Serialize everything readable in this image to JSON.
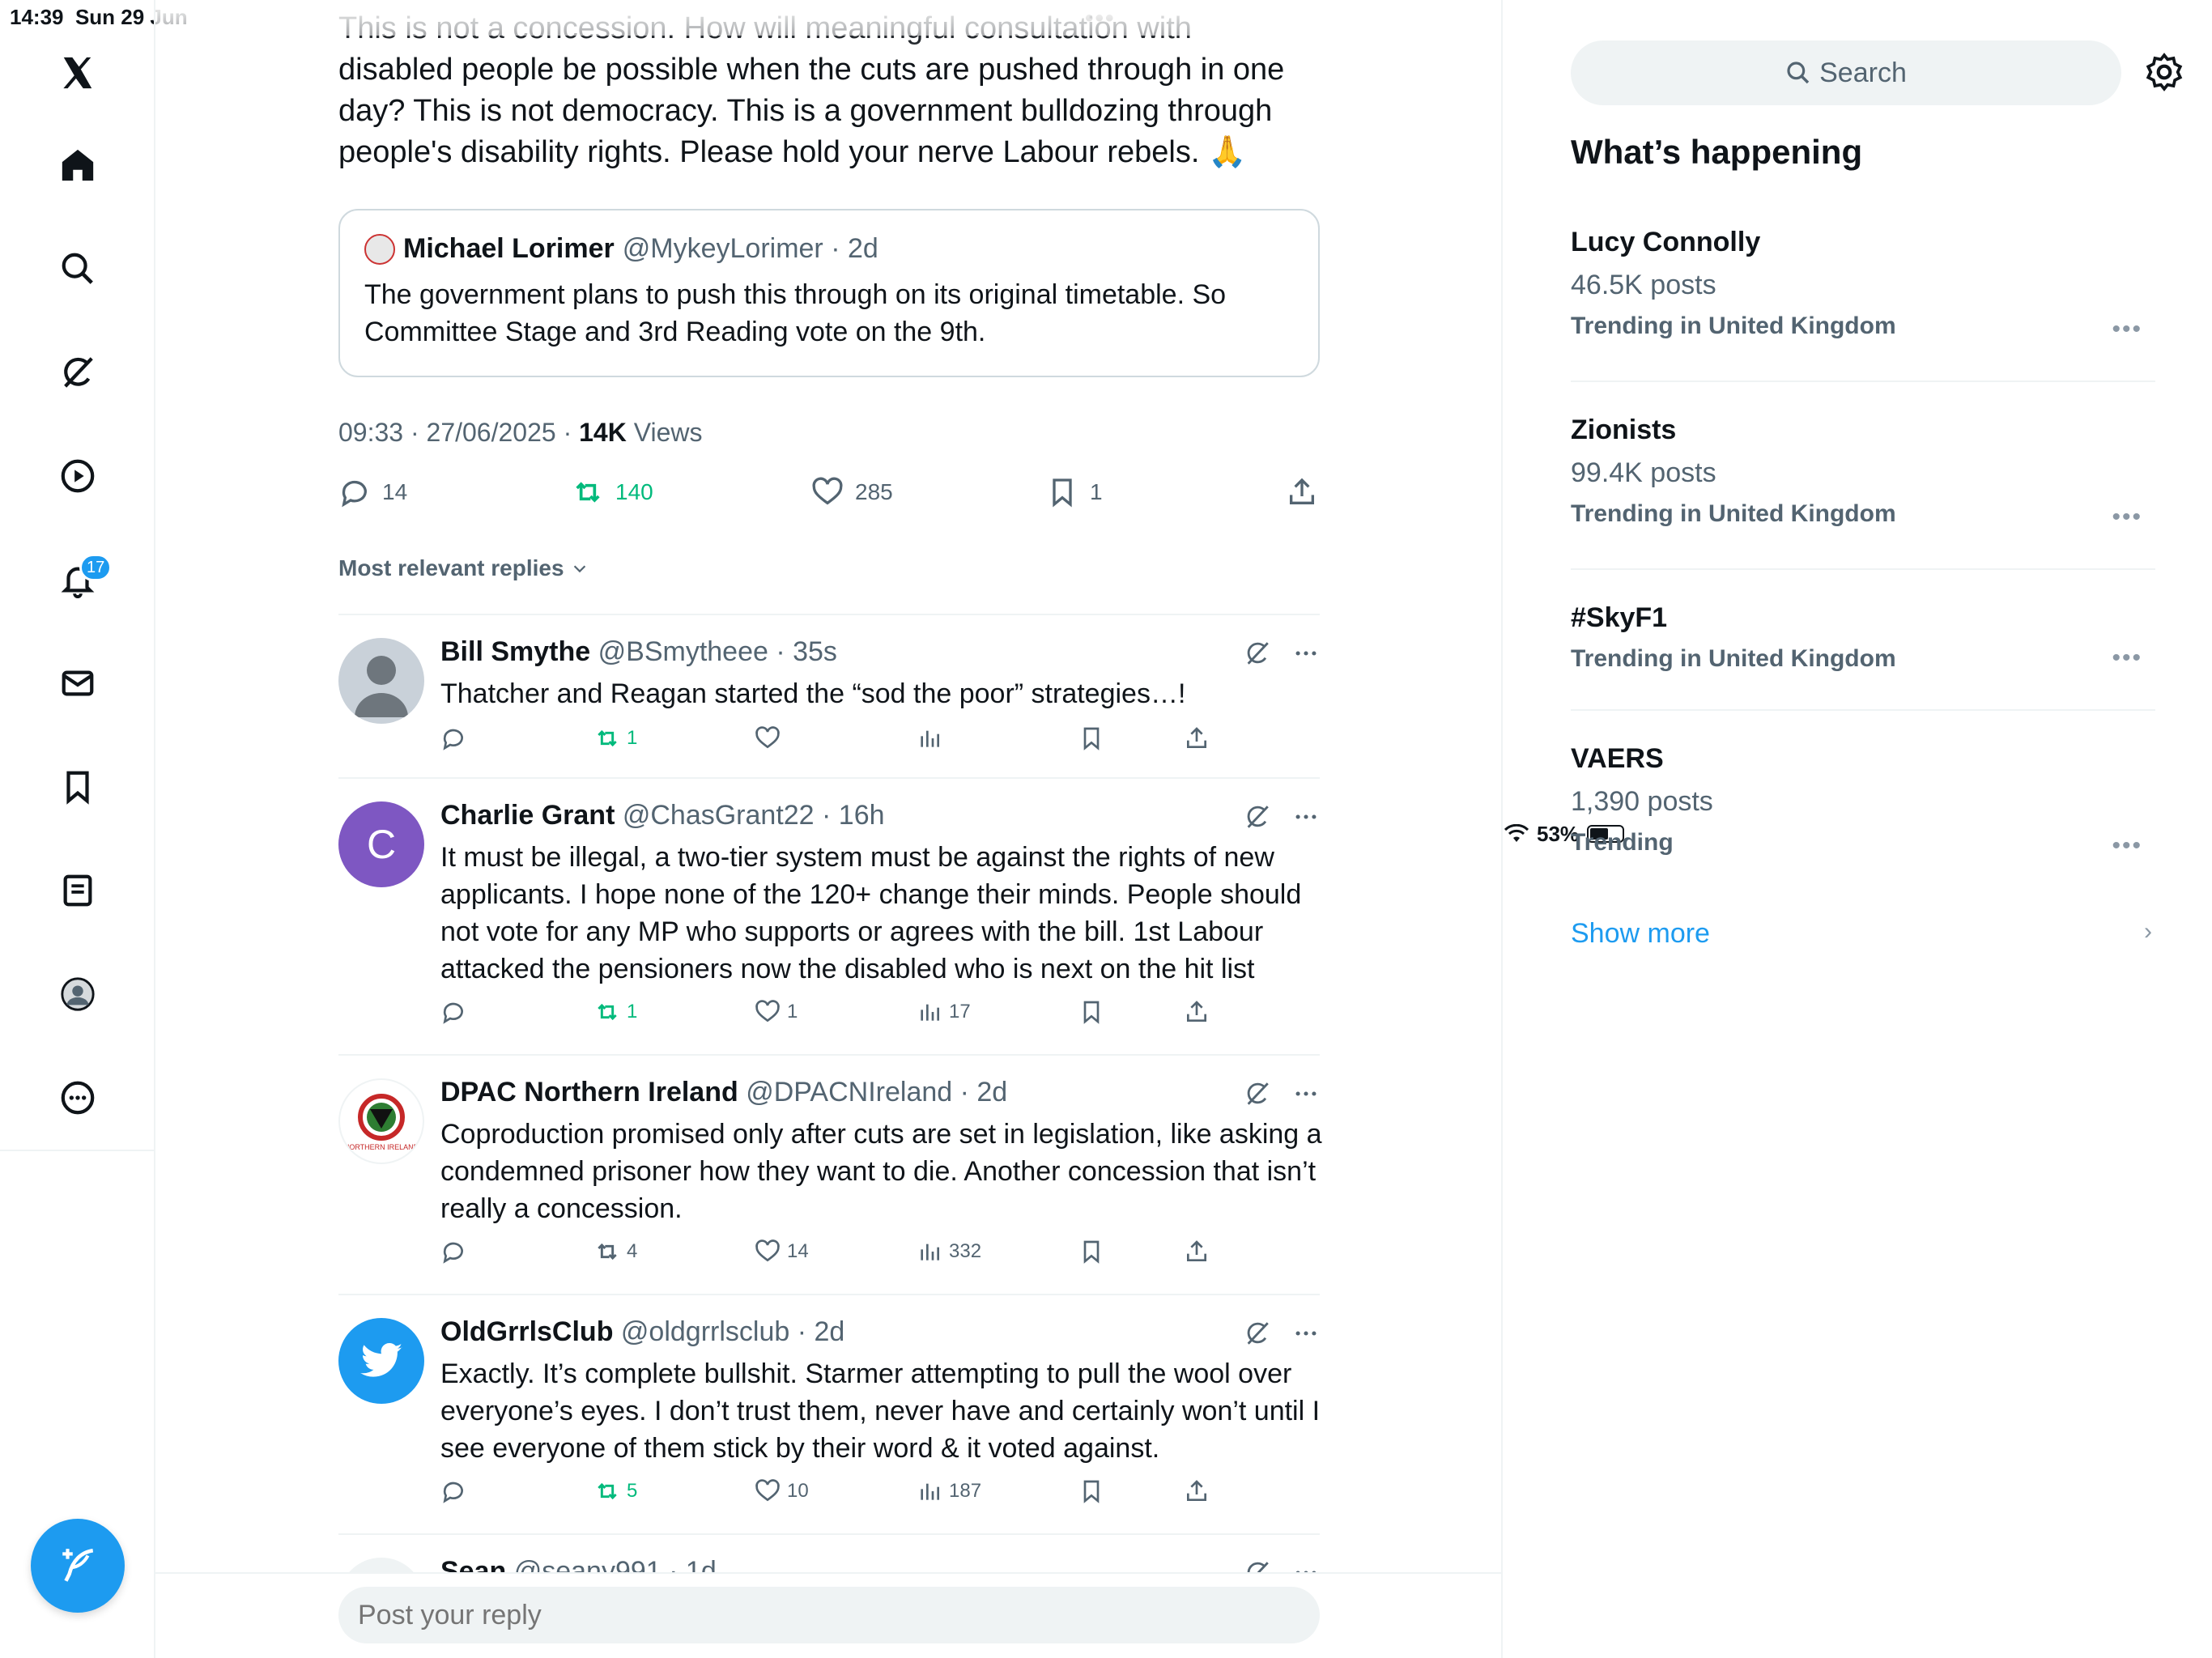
{
  "status_bar": {
    "time": "14:39",
    "date": "Sun 29 Jun",
    "battery": "53%",
    "battery_level": 0.53
  },
  "sidebar": {
    "items": [
      {
        "icon": "x-logo-icon"
      },
      {
        "icon": "home-icon"
      },
      {
        "icon": "search-icon"
      },
      {
        "icon": "grok-icon"
      },
      {
        "icon": "video-icon"
      },
      {
        "icon": "notifications-icon"
      },
      {
        "icon": "messages-icon"
      },
      {
        "icon": "bookmarks-icon"
      },
      {
        "icon": "lists-icon"
      },
      {
        "icon": "profile-icon"
      },
      {
        "icon": "more-icon"
      }
    ],
    "notification_count": "17",
    "compose_icon": "compose-icon"
  },
  "tweet": {
    "text_cut": "This is not a concession. How will meaningful consultation with",
    "text": "disabled people be possible when the cuts are pushed through in one day? This is not democracy. This is a government bulldozing through people's disability rights. Please hold your nerve Labour rebels. 🙏",
    "quote": {
      "name": "Michael Lorimer",
      "handle": "@MykeyLorimer",
      "time": "2d",
      "text": "The government plans to push this through on its original timetable. So Committee Stage and 3rd Reading vote on the 9th."
    },
    "timestamp": "09:33 · 27/06/2025 · ",
    "views_count": "14K",
    "views_label": " Views",
    "stats": {
      "replies": "14",
      "reposts": "140",
      "likes": "285",
      "bookmarks": "1"
    }
  },
  "most_relevant_label": "Most relevant replies",
  "replies": [
    {
      "name": "Bill Smythe",
      "meta": "@BSmytheee · 35s",
      "text": "Thatcher and Reagan started the “sod the poor” strategies…!",
      "reposts": "1",
      "likes": "",
      "views": ""
    },
    {
      "name": "Charlie Grant",
      "meta": "@ChasGrant22 · 16h",
      "avatar_letter": "C",
      "text": "It must be illegal, a two-tier system must be against the rights of new applicants. I hope none of the 120+ change their minds. People should not vote for any MP who supports or agrees with the bill. 1st Labour attacked the pensioners now the disabled who is next on the hit list",
      "reposts": "1",
      "likes": "1",
      "views": "17"
    },
    {
      "name": "DPAC Northern Ireland",
      "meta": "@DPACNIreland · 2d",
      "text": "Coproduction promised only after cuts are set in legislation, like asking a condemned prisoner how they want to die. Another concession that isn’t really a concession.",
      "reposts": "4",
      "likes": "14",
      "views": "332"
    },
    {
      "name": "OldGrrlsClub",
      "meta": "@oldgrrlsclub · 2d",
      "text": "Exactly. It’s complete bullshit. Starmer attempting to pull the wool over everyone’s eyes. I don’t trust them, never have and certainly won’t until I see everyone of them stick by their word & it voted against.",
      "reposts": "5",
      "likes": "10",
      "views": "187"
    },
    {
      "name": "Sean",
      "meta": "@seany991 · 1d"
    }
  ],
  "reply_placeholder": "Post your reply",
  "right": {
    "search_placeholder": "Search",
    "heading": "What’s happening",
    "trends": [
      {
        "name": "Lucy Connolly",
        "posts": "46.5K posts",
        "context": "Trending in United Kingdom"
      },
      {
        "name": "Zionists",
        "posts": "99.4K posts",
        "context": "Trending in United Kingdom"
      },
      {
        "name": "#SkyF1",
        "posts": "",
        "context": "Trending in United Kingdom"
      },
      {
        "name": "VAERS",
        "posts": "1,390 posts",
        "context": "Trending"
      }
    ],
    "show_more": "Show more"
  },
  "colors": {
    "accent": "#1d9bf0",
    "repost_green": "#00ba7c",
    "muted": "#536471",
    "border": "#eff3f4"
  }
}
